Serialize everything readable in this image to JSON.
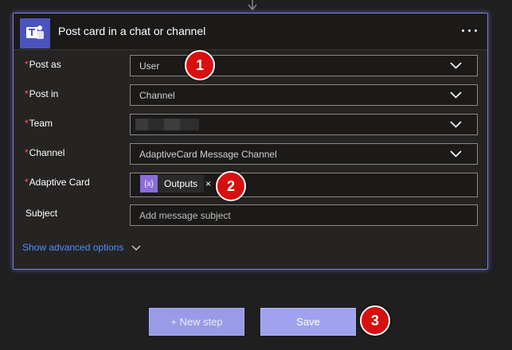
{
  "card": {
    "title": "Post card in a chat or channel",
    "icon": "teams-icon",
    "menu_icon": "more-dots-icon"
  },
  "fields": [
    {
      "required_marker": "*",
      "label": "Post as",
      "value": "User"
    },
    {
      "required_marker": "*",
      "label": "Post in",
      "value": "Channel"
    },
    {
      "required_marker": "*",
      "label": "Team",
      "value": ""
    },
    {
      "required_marker": "*",
      "label": "Channel",
      "value": "AdaptiveCard Message Channel"
    },
    {
      "required_marker": "*",
      "label": "Adaptive Card",
      "token_label": "Outputs",
      "token_icon": "{x}",
      "token_remove": "×"
    },
    {
      "label": "Subject",
      "placeholder": "Add message subject"
    }
  ],
  "advanced": {
    "label": "Show advanced options"
  },
  "buttons": {
    "new_step": "+ New step",
    "save": "Save"
  },
  "badges": [
    "1",
    "2",
    "3"
  ],
  "colors": {
    "accent": "#4b53bc",
    "card_border": "#7c7fd4",
    "required": "#ff5c5c",
    "link": "#4f8cff",
    "badge": "#d80f0f",
    "token": "#8c6cda",
    "button": "#a0a2f0"
  }
}
